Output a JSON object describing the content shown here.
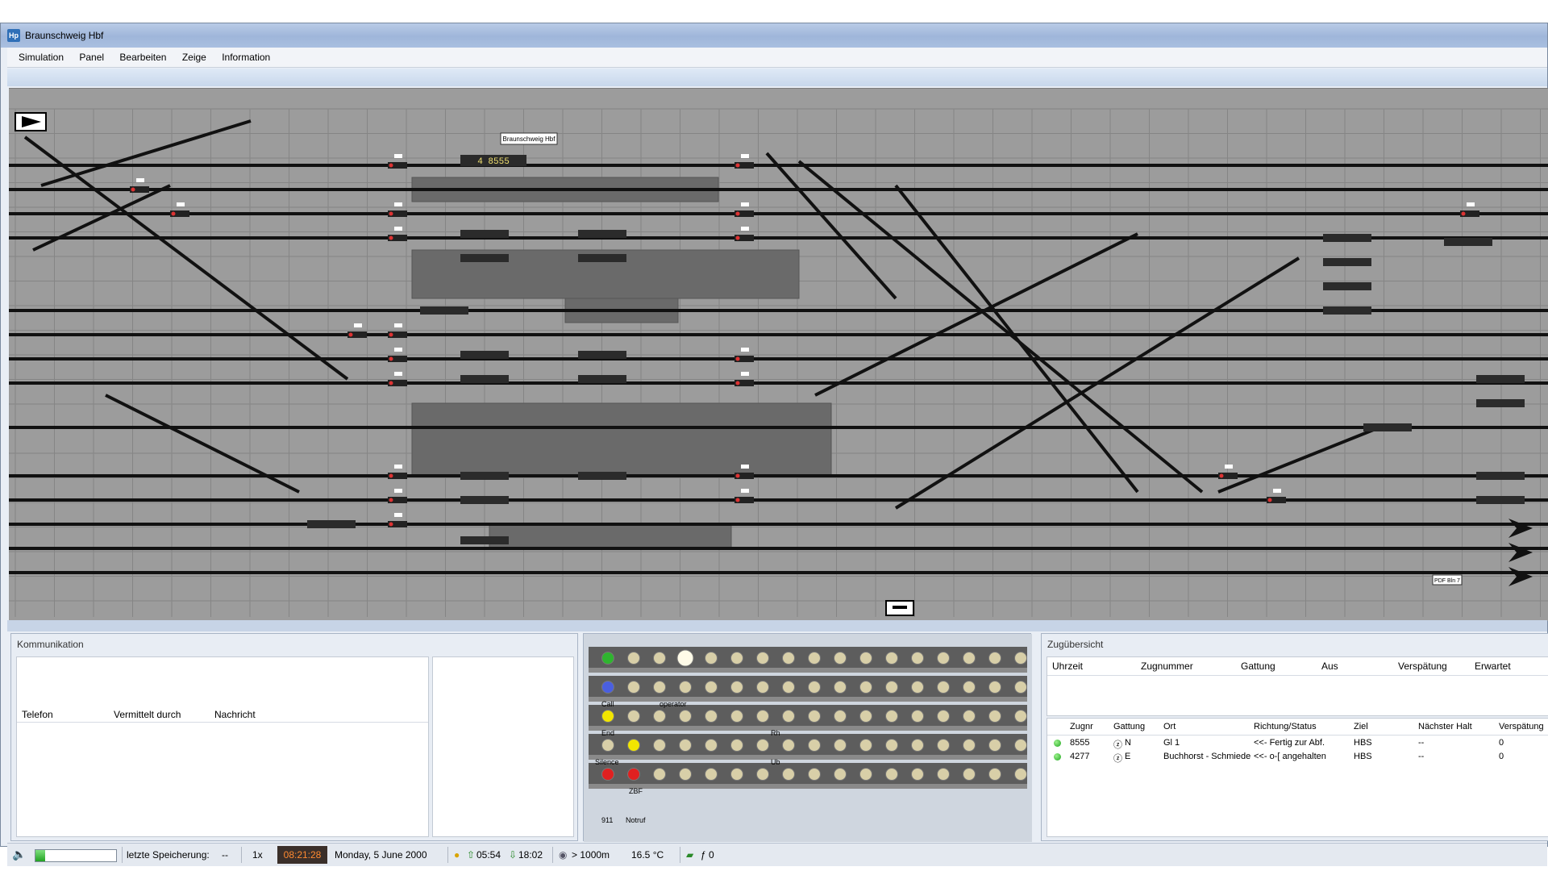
{
  "window": {
    "title": "Braunschweig Hbf",
    "icon_text": "Hp"
  },
  "menu": [
    "Simulation",
    "Panel",
    "Bearbeiten",
    "Zeige",
    "Information"
  ],
  "board": {
    "station_label": "Braunschweig Hbf",
    "train_display": "4  8555",
    "right_label": "PDF Bln 7"
  },
  "kommunikation": {
    "title": "Kommunikation",
    "columns": [
      "Telefon",
      "Vermittelt durch",
      "Nachricht"
    ]
  },
  "lamp_panel": {
    "labels": [
      "Call",
      "operator",
      "End",
      "Rh",
      "Silence",
      "Ub",
      "ZBF",
      "911",
      "Notruf"
    ],
    "colors": {
      "green": "#2fb52f",
      "blue": "#4a5fe0",
      "yellow": "#f2e600",
      "red": "#e02020",
      "off": "#d8cfa8",
      "white": "#fffbe8"
    }
  },
  "zuguebersicht": {
    "title": "Zugübersicht",
    "top_columns": [
      "Uhrzeit",
      "Zugnummer",
      "Gattung",
      "Aus",
      "Verspätung",
      "Erwartet"
    ],
    "columns": [
      "Zugnr",
      "Gattung",
      "Ort",
      "Richtung/Status",
      "Ziel",
      "Nächster Halt",
      "Verspätung"
    ],
    "rows": [
      {
        "zugnr": "8555",
        "gattung": "N",
        "ort": "Gl 1",
        "status": "<<- Fertig zur Abf.",
        "ziel": "HBS",
        "halt": "--",
        "versp": "0"
      },
      {
        "zugnr": "4277",
        "gattung": "E",
        "ort": "Buchhorst - Schmiede",
        "status": "<<- o-[ angehalten",
        "ziel": "HBS",
        "halt": "--",
        "versp": "0"
      }
    ]
  },
  "statusbar": {
    "save_label": "letzte Speicherung:",
    "save_value": "--",
    "speed": "1x",
    "time": "08:21:28",
    "date": "Monday, 5 June 2000",
    "sunrise": "05:54",
    "sunset": "18:02",
    "visibility": "> 1000m",
    "temperature": "16.5 °C",
    "counter": "ƒ 0",
    "progress_fraction": 0.12
  }
}
